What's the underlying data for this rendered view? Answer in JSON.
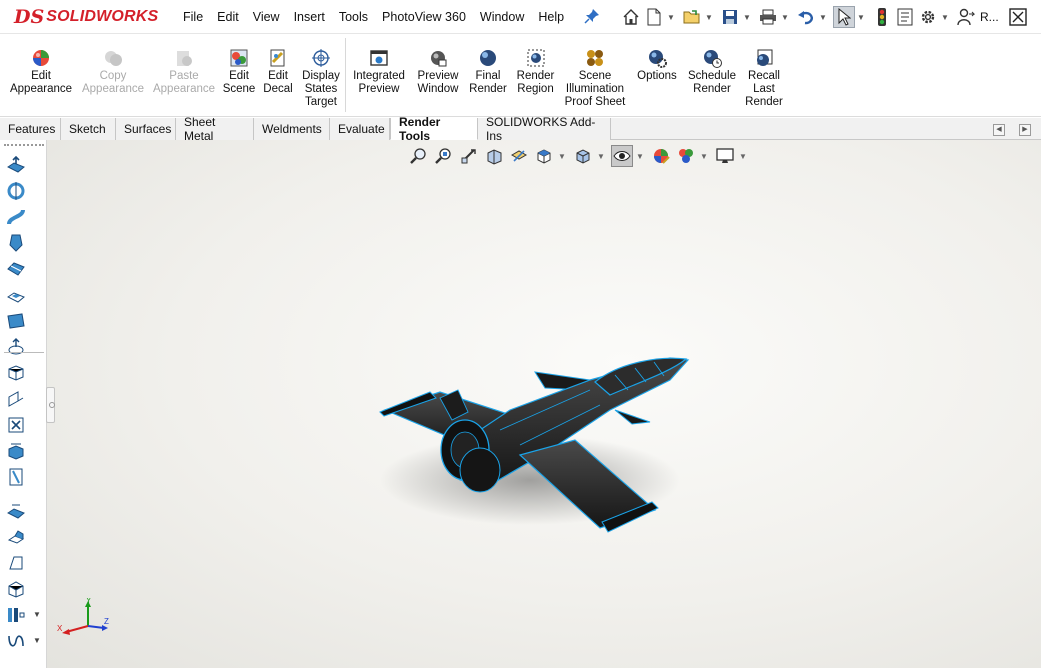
{
  "app": {
    "brand_ds": "DS",
    "brand_name": "SOLIDWORKS"
  },
  "menu": [
    "File",
    "Edit",
    "View",
    "Insert",
    "Tools",
    "PhotoView 360",
    "Window",
    "Help"
  ],
  "quick_access": {
    "overflow_label": "R..."
  },
  "command_manager": {
    "buttons": [
      {
        "label_lines": [
          "Edit",
          "Appearance"
        ],
        "enabled": true
      },
      {
        "label_lines": [
          "Copy",
          "Appearance"
        ],
        "enabled": false
      },
      {
        "label_lines": [
          "Paste",
          "Appearance"
        ],
        "enabled": false
      },
      {
        "label_lines": [
          "Edit",
          "Scene"
        ],
        "enabled": true
      },
      {
        "label_lines": [
          "Edit",
          "Decal"
        ],
        "enabled": true
      },
      {
        "label_lines": [
          "Display",
          "States",
          "Target"
        ],
        "enabled": true
      },
      {
        "label_lines": [
          "Integrated",
          "Preview"
        ],
        "enabled": true
      },
      {
        "label_lines": [
          "Preview",
          "Window"
        ],
        "enabled": true
      },
      {
        "label_lines": [
          "Final",
          "Render"
        ],
        "enabled": true
      },
      {
        "label_lines": [
          "Render",
          "Region"
        ],
        "enabled": true
      },
      {
        "label_lines": [
          "Scene",
          "Illumination",
          "Proof Sheet"
        ],
        "enabled": true
      },
      {
        "label_lines": [
          "Options"
        ],
        "enabled": true
      },
      {
        "label_lines": [
          "Schedule",
          "Render"
        ],
        "enabled": true
      },
      {
        "label_lines": [
          "Recall",
          "Last",
          "Render"
        ],
        "enabled": true
      }
    ]
  },
  "tabs": [
    {
      "label": "Features",
      "active": false
    },
    {
      "label": "Sketch",
      "active": false
    },
    {
      "label": "Surfaces",
      "active": false
    },
    {
      "label": "Sheet Metal",
      "active": false
    },
    {
      "label": "Weldments",
      "active": false
    },
    {
      "label": "Evaluate",
      "active": false
    },
    {
      "label": "Render Tools",
      "active": true
    },
    {
      "label": "SOLIDWORKS Add-Ins",
      "active": false
    }
  ],
  "triad": {
    "x": "X",
    "y": "Y",
    "z": "Z"
  },
  "colors": {
    "brand_red": "#d4202a",
    "model_edge_blue": "#1aa3e8",
    "model_body": "#2a2a2a"
  }
}
